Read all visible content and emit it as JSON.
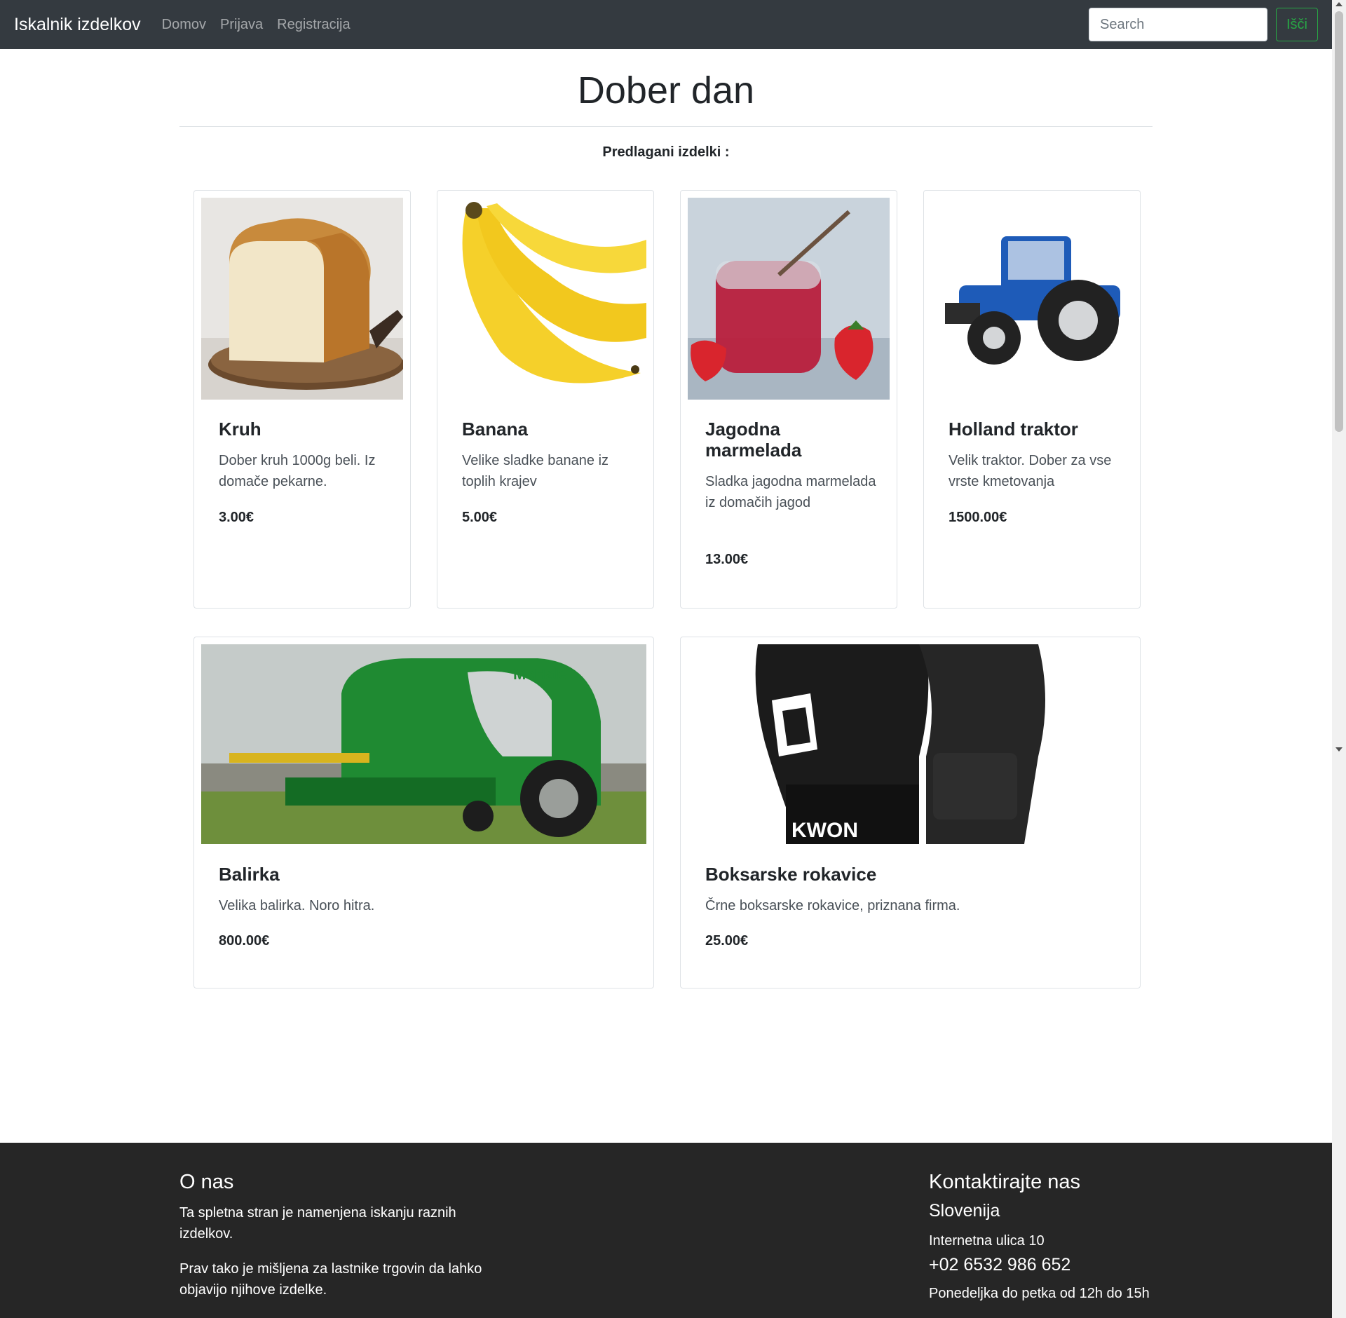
{
  "navbar": {
    "brand": "Iskalnik izdelkov",
    "links": [
      "Domov",
      "Prijava",
      "Registracija"
    ],
    "search_placeholder": "Search",
    "search_button": "Išči"
  },
  "main": {
    "title": "Dober dan",
    "subtitle": "Predlagani izdelki :"
  },
  "products": [
    {
      "name": "Kruh",
      "description": "Dober kruh 1000g beli. Iz domače pekarne.",
      "price": "3.00€",
      "image": "bread-image"
    },
    {
      "name": "Banana",
      "description": "Velike sladke banane iz toplih krajev",
      "price": "5.00€",
      "image": "banana-image"
    },
    {
      "name": "Jagodna marmelada",
      "description": "Sladka jagodna marmelada iz domačih jagod",
      "price": "13.00€",
      "image": "jam-image"
    },
    {
      "name": "Holland traktor",
      "description": "Velik traktor. Dober za vse vrste kmetovanja",
      "price": "1500.00€",
      "image": "tractor-image"
    },
    {
      "name": "Balirka",
      "description": "Velika balirka. Noro hitra.",
      "price": "800.00€",
      "image": "baler-image"
    },
    {
      "name": "Boksarske rokavice",
      "description": "Črne boksarske rokavice, priznana firma.",
      "price": "25.00€",
      "image": "boxing-gloves-image"
    }
  ],
  "footer": {
    "about_title": "O nas",
    "about_p1": "Ta spletna stran je namenjena iskanju raznih izdelkov.",
    "about_p2": "Prav tako je mišljena za lastnike trgovin da lahko objavijo njihove izdelke.",
    "contact_title": "Kontaktirajte nas",
    "country": "Slovenija",
    "address": "Internetna ulica 10",
    "phone": "+02 6532 986 652",
    "hours": "Ponedeljka do petka od 12h do 15h"
  },
  "colors": {
    "navbar_bg": "#343a40",
    "footer_bg": "#262626",
    "accent_green": "#28a745"
  }
}
